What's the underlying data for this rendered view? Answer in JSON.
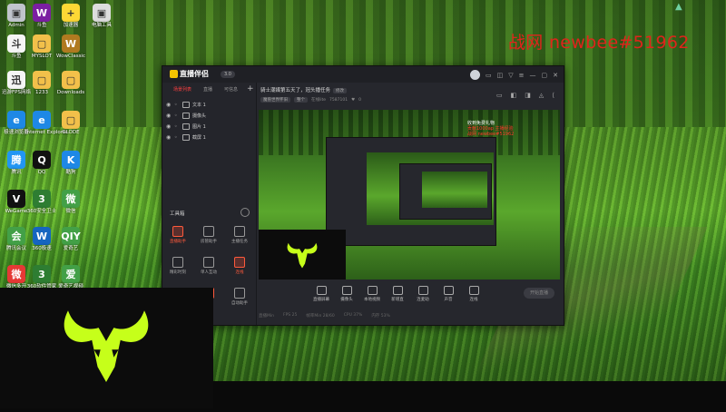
{
  "overlay": {
    "streamer_text": "战网 newbee#51962"
  },
  "desktop_icons": [
    {
      "label": "Admin",
      "color": "#c0c4cc",
      "glyph": "▣"
    },
    {
      "label": "斗鱼",
      "color": "#f5f5f5",
      "glyph": "斗"
    },
    {
      "label": "迅游FPS网络",
      "color": "#f5f5f5",
      "glyph": "迅"
    },
    {
      "label": "极速浏览器",
      "color": "#1e88e5",
      "glyph": "e"
    },
    {
      "label": "腾讯",
      "color": "#2196f3",
      "glyph": "腾"
    },
    {
      "label": "WeGame",
      "color": "#111111",
      "glyph": "V"
    },
    {
      "label": "腾讯会议",
      "color": "#43a047",
      "glyph": "会"
    },
    {
      "label": "微信多开",
      "color": "#e53935",
      "glyph": "微"
    },
    {
      "label": "斗鱼",
      "color": "#7b1fa2",
      "glyph": "W"
    },
    {
      "label": "MYSLOT",
      "color": "#f2c04a",
      "glyph": "▢"
    },
    {
      "label": "1233",
      "color": "#f2c04a",
      "glyph": "▢"
    },
    {
      "label": "Internet Explorer",
      "color": "#1e88e5",
      "glyph": "e"
    },
    {
      "label": "QQ",
      "color": "#111111",
      "glyph": "Q"
    },
    {
      "label": "360安全卫士",
      "color": "#2e7d32",
      "glyph": "3"
    },
    {
      "label": "360极速",
      "color": "#1565c0",
      "glyph": "W"
    },
    {
      "label": "360软件管家",
      "color": "#2e7d32",
      "glyph": "3"
    },
    {
      "label": "加速器",
      "color": "#fdd835",
      "glyph": "+"
    },
    {
      "label": "WowClassic",
      "color": "#b07a20",
      "glyph": "W"
    },
    {
      "label": "Downloads",
      "color": "#f2c04a",
      "glyph": "▢"
    },
    {
      "label": "GLODE",
      "color": "#f2c04a",
      "glyph": "▢"
    },
    {
      "label": "酷狗",
      "color": "#1e88e5",
      "glyph": "K"
    },
    {
      "label": "微信",
      "color": "#43a047",
      "glyph": "微"
    },
    {
      "label": "爱奇艺",
      "color": "#43a047",
      "glyph": "QIY"
    },
    {
      "label": "爱奇艺视频",
      "color": "#43a047",
      "glyph": "爱"
    },
    {
      "label": "电脑工具",
      "color": "#ddd",
      "glyph": "▣"
    }
  ],
  "app": {
    "logo_text": "直播伴侣",
    "version": "3.0",
    "tabs": [
      "场景列表",
      "直播",
      "可信息"
    ],
    "scenes": [
      "文本 1",
      "摄像头",
      "图片 1",
      "截屏 1"
    ],
    "tools_title": "工具箱",
    "tools": [
      {
        "label": "直播助手",
        "red": true
      },
      {
        "label": "房管助手",
        "red": false
      },
      {
        "label": "主播任务",
        "red": false
      },
      {
        "label": "精彩时刻",
        "red": false
      },
      {
        "label": "单人互动",
        "red": false
      },
      {
        "label": "连线",
        "red": true
      },
      {
        "label": "房间管理",
        "red": false
      },
      {
        "label": "弹幕",
        "red": true
      },
      {
        "label": "自动助手",
        "red": false
      }
    ],
    "stream_title": "骑士潮媒第五天了，冠头播任务",
    "edit_label": "修改",
    "meta": [
      "魔兽世界怀旧",
      "整个",
      "在线lite",
      "7587101",
      "0"
    ],
    "bottom_tools": [
      "直播屏幕",
      "摄像头",
      "本地视频",
      "新增直",
      "连麦助",
      "声音",
      "连线"
    ],
    "start_button": "开始直播",
    "status_items": [
      "直播Min",
      "FPS 25",
      "帧率Min 28/60",
      "CPU 37%",
      "内存 53%"
    ],
    "preview_overlay_line1": "收到免费礼物",
    "preview_overlay_line2": "贡献1000ap 主播经验",
    "preview_overlay_line3": "战网 newbee#51962"
  },
  "colors": {
    "accent": "#ff4040",
    "emblem": "#c6ff1a",
    "overlay": "#e0241b"
  }
}
